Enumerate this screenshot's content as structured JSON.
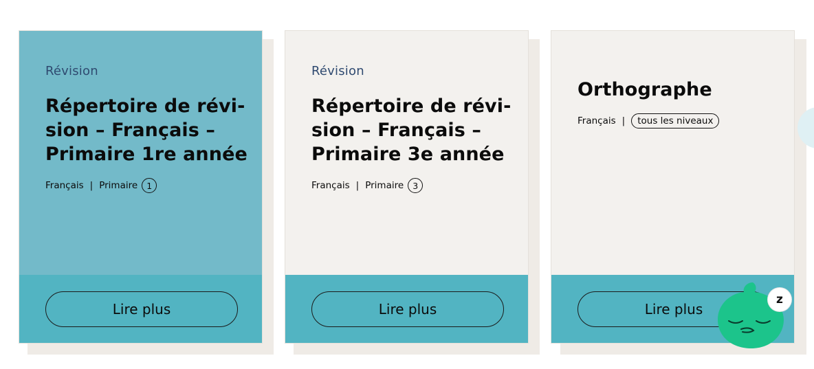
{
  "cards": [
    {
      "kicker": "Révision",
      "title_lines": [
        "Répertoire de révi-",
        "sion – Français –",
        "Primaire 1re année"
      ],
      "subject": "Français",
      "separator": "|",
      "level": "Primaire",
      "grade": "1",
      "button_label": "Lire plus"
    },
    {
      "kicker": "Révision",
      "title_lines": [
        "Répertoire de révi-",
        "sion – Français –",
        "Primaire 3e année"
      ],
      "subject": "Français",
      "separator": "|",
      "level": "Primaire",
      "grade": "3",
      "button_label": "Lire plus"
    },
    {
      "title": "Orthographe",
      "subject": "Français",
      "separator": "|",
      "level_pill": "tous les niveaux",
      "button_label": "Lire plus"
    }
  ],
  "mascot": {
    "badge_letter": "z"
  },
  "colors": {
    "card_blue": "#73bac9",
    "card_grey": "#f3f1ee",
    "footer_teal": "#52b4c2",
    "mascot_green": "#1cc48b",
    "kicker_navy": "#2f4a70"
  }
}
